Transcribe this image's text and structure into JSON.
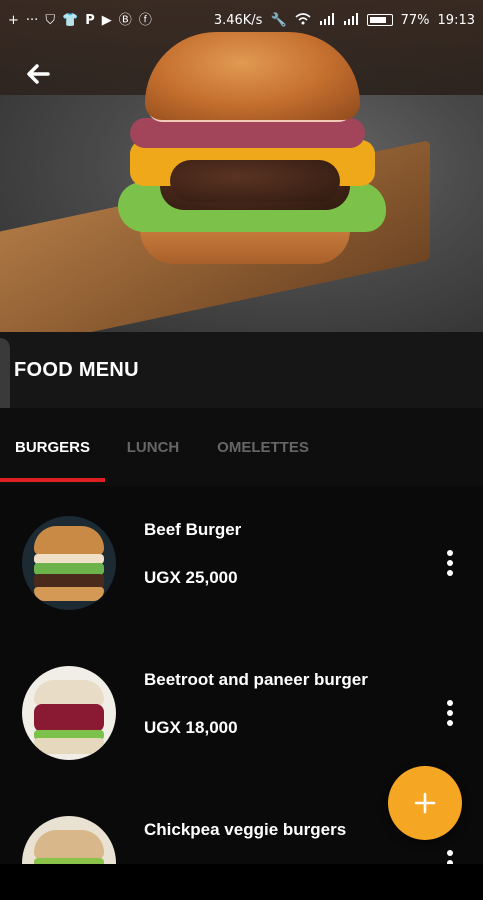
{
  "status_bar": {
    "network_speed": "3.46K/s",
    "battery_percent": "77%",
    "time": "19:13",
    "left_icons": [
      "plus-icon",
      "more-icon",
      "shield-icon",
      "shirt-icon",
      "p-app-icon",
      "youtube-icon",
      "crypto-icon",
      "facebook-icon"
    ],
    "right_icons": [
      "wrench-icon",
      "wifi-icon",
      "signal-icon",
      "signal-icon",
      "battery-icon"
    ]
  },
  "hero": {
    "back_icon": "back-arrow-icon"
  },
  "header": {
    "title": "FOOD MENU"
  },
  "tabs": [
    {
      "label": "BURGERS",
      "active": true
    },
    {
      "label": "LUNCH",
      "active": false
    },
    {
      "label": "OMELETTES",
      "active": false
    }
  ],
  "menu_items": [
    {
      "name": "Beef Burger",
      "price": "UGX 25,000"
    },
    {
      "name": "Beetroot and paneer burger",
      "price": "UGX 18,000"
    },
    {
      "name": "Chickpea veggie burgers",
      "price": ""
    }
  ],
  "fab": {
    "icon": "plus-icon"
  },
  "colors": {
    "accent_red": "#e02020",
    "fab_orange": "#f5a623",
    "header_bg": "#161616",
    "list_bg": "#0a0a0a"
  }
}
